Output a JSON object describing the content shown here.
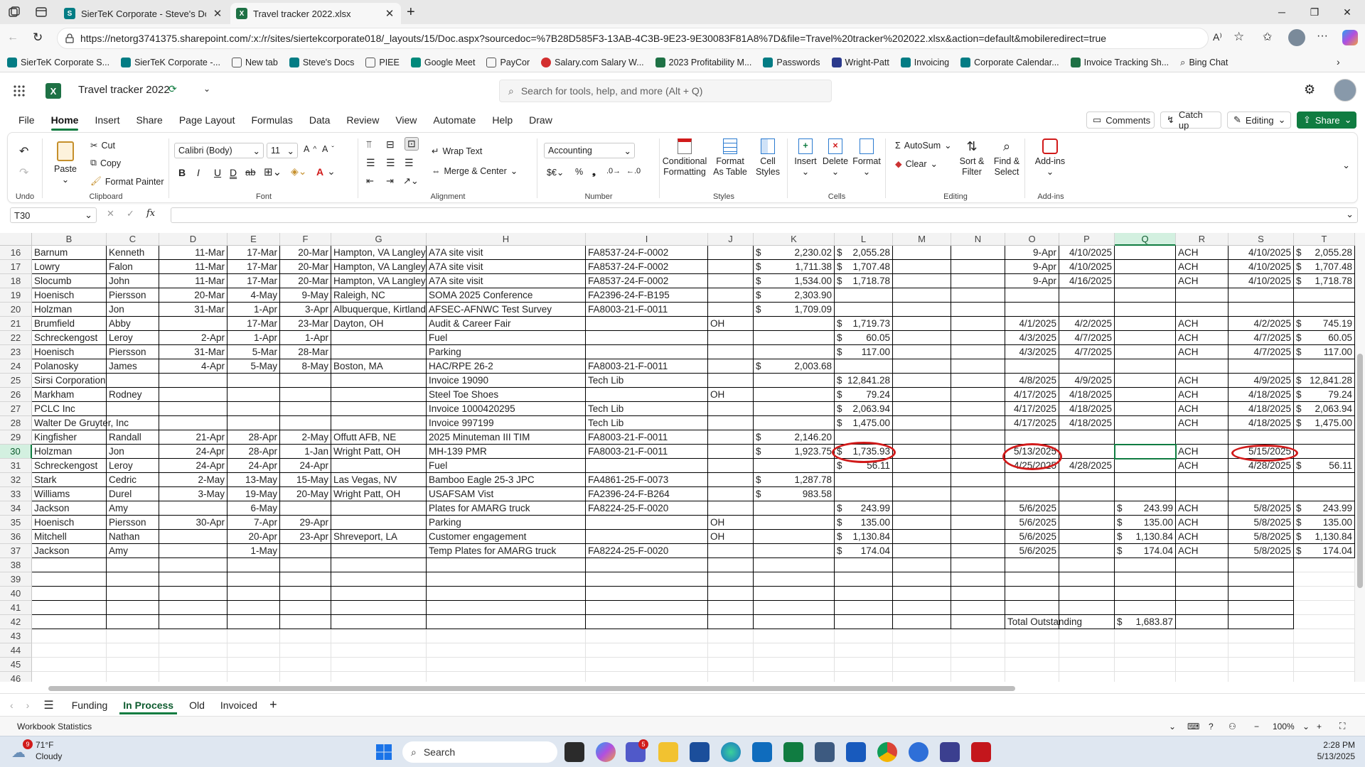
{
  "browser": {
    "tabs": [
      {
        "label": "SierTeK Corporate - Steve's Docs",
        "active": false
      },
      {
        "label": "Travel tracker 2022.xlsx",
        "active": true
      }
    ],
    "url": "https://netorg3741375.sharepoint.com/:x:/r/sites/siertekcorporate018/_layouts/15/Doc.aspx?sourcedoc=%7B28D585F3-13AB-4C3B-9E23-9E30083F81A8%7D&file=Travel%20tracker%202022.xlsx&action=default&mobileredirect=true",
    "bookmarks": [
      "SierTeK Corporate S...",
      "SierTeK Corporate -...",
      "New tab",
      "Steve's Docs",
      "PIEE",
      "Google Meet",
      "PayCor",
      "Salary.com Salary W...",
      "2023 Profitability M...",
      "Passwords",
      "Wright-Patt",
      "Invoicing",
      "Corporate Calendar...",
      "Invoice Tracking Sh...",
      "Bing Chat"
    ]
  },
  "excel": {
    "file_title": "Travel tracker 2022",
    "search_placeholder": "Search for tools, help, and more (Alt + Q)",
    "menus": [
      "File",
      "Home",
      "Insert",
      "Share",
      "Page Layout",
      "Formulas",
      "Data",
      "Review",
      "View",
      "Automate",
      "Help",
      "Draw"
    ],
    "buttons": {
      "comments": "Comments",
      "catchup": "Catch up",
      "editing": "Editing",
      "share": "Share"
    },
    "ribbon": {
      "undo_label": "Undo",
      "paste": "Paste",
      "cut": "Cut",
      "copy": "Copy",
      "format_painter": "Format Painter",
      "clipboard_label": "Clipboard",
      "font_name": "Calibri (Body)",
      "font_size": "11",
      "font_label": "Font",
      "wrap_text": "Wrap Text",
      "merge_center": "Merge & Center",
      "alignment_label": "Alignment",
      "number_format": "Accounting",
      "number_label": "Number",
      "conditional": "Conditional Formatting",
      "format_table": "Format As Table",
      "cell_styles": "Cell Styles",
      "styles_label": "Styles",
      "insert": "Insert",
      "delete": "Delete",
      "format": "Format",
      "cells_label": "Cells",
      "autosum": "AutoSum",
      "clear": "Clear",
      "sort_filter": "Sort & Filter",
      "find_select": "Find & Select",
      "editing_label": "Editing",
      "addins": "Add-ins",
      "addins_label": "Add-ins"
    },
    "name_box": "T30",
    "fx": "fx",
    "columns": [
      "B",
      "C",
      "D",
      "E",
      "F",
      "G",
      "H",
      "I",
      "J",
      "K",
      "L",
      "M",
      "N",
      "O",
      "P",
      "Q",
      "R",
      "S",
      "T"
    ],
    "rows": [
      {
        "n": "16",
        "B": "Barnum",
        "C": "Kenneth",
        "D": "11-Mar",
        "E": "17-Mar",
        "F": "20-Mar",
        "G": "Hampton, VA Langley",
        "H": "A7A site visit",
        "I": "FA8537-24-F-0002",
        "J": "",
        "K": "2,230.02",
        "L": "2,055.28",
        "M": "",
        "N": "",
        "O": "9-Apr",
        "P": "4/10/2025",
        "Q": "",
        "R": "ACH",
        "S": "4/10/2025",
        "T": "2,055.28"
      },
      {
        "n": "17",
        "B": "Lowry",
        "C": "Falon",
        "D": "11-Mar",
        "E": "17-Mar",
        "F": "20-Mar",
        "G": "Hampton, VA Langley",
        "H": "A7A site visit",
        "I": "FA8537-24-F-0002",
        "J": "",
        "K": "1,711.38",
        "L": "1,707.48",
        "M": "",
        "N": "",
        "O": "9-Apr",
        "P": "4/10/2025",
        "Q": "",
        "R": "ACH",
        "S": "4/10/2025",
        "T": "1,707.48"
      },
      {
        "n": "18",
        "B": "Slocumb",
        "C": "John",
        "D": "11-Mar",
        "E": "17-Mar",
        "F": "20-Mar",
        "G": "Hampton, VA Langley",
        "H": "A7A site visit",
        "I": "FA8537-24-F-0002",
        "J": "",
        "K": "1,534.00",
        "L": "1,718.78",
        "M": "",
        "N": "",
        "O": "9-Apr",
        "P": "4/16/2025",
        "Q": "",
        "R": "ACH",
        "S": "4/10/2025",
        "T": "1,718.78"
      },
      {
        "n": "19",
        "B": "Hoenisch",
        "C": "Piersson",
        "D": "20-Mar",
        "E": "4-May",
        "F": "9-May",
        "G": "Raleigh, NC",
        "H": "SOMA 2025 Conference",
        "I": "FA2396-24-F-B195",
        "J": "",
        "K": "2,303.90",
        "L": "",
        "M": "",
        "N": "",
        "O": "",
        "P": "",
        "Q": "",
        "R": "",
        "S": "",
        "T": ""
      },
      {
        "n": "20",
        "B": "Holzman",
        "C": "Jon",
        "D": "31-Mar",
        "E": "1-Apr",
        "F": "3-Apr",
        "G": "Albuquerque, Kirtland",
        "H": "AFSEC-AFNWC Test Survey",
        "I": "FA8003-21-F-0011",
        "J": "",
        "K": "1,709.09",
        "L": "",
        "M": "",
        "N": "",
        "O": "",
        "P": "",
        "Q": "",
        "R": "",
        "S": "",
        "T": ""
      },
      {
        "n": "21",
        "B": "Brumfield",
        "C": "Abby",
        "D": "",
        "E": "17-Mar",
        "F": "23-Mar",
        "G": "Dayton, OH",
        "H": "Audit & Career Fair",
        "I": "",
        "J": "OH",
        "K": "",
        "L": "1,719.73",
        "M": "",
        "N": "",
        "O": "4/1/2025",
        "P": "4/2/2025",
        "Q": "",
        "R": "ACH",
        "S": "4/2/2025",
        "T": "745.19"
      },
      {
        "n": "22",
        "B": "Schreckengost",
        "C": "Leroy",
        "D": "2-Apr",
        "E": "1-Apr",
        "F": "1-Apr",
        "G": "",
        "H": "Fuel",
        "I": "",
        "J": "",
        "K": "",
        "L": "60.05",
        "M": "",
        "N": "",
        "O": "4/3/2025",
        "P": "4/7/2025",
        "Q": "",
        "R": "ACH",
        "S": "4/7/2025",
        "T": "60.05"
      },
      {
        "n": "23",
        "B": "Hoenisch",
        "C": "Piersson",
        "D": "31-Mar",
        "E": "5-Mar",
        "F": "28-Mar",
        "G": "",
        "H": "Parking",
        "I": "",
        "J": "",
        "K": "",
        "L": "117.00",
        "M": "",
        "N": "",
        "O": "4/3/2025",
        "P": "4/7/2025",
        "Q": "",
        "R": "ACH",
        "S": "4/7/2025",
        "T": "117.00"
      },
      {
        "n": "24",
        "B": "Polanosky",
        "C": "James",
        "D": "4-Apr",
        "E": "5-May",
        "F": "8-May",
        "G": "Boston, MA",
        "H": "HAC/RPE 26-2",
        "I": "FA8003-21-F-0011",
        "J": "",
        "K": "2,003.68",
        "L": "",
        "M": "",
        "N": "",
        "O": "",
        "P": "",
        "Q": "",
        "R": "",
        "S": "",
        "T": ""
      },
      {
        "n": "25",
        "B": "Sirsi Corporation",
        "C": "",
        "D": "",
        "E": "",
        "F": "",
        "G": "",
        "H": "Invoice 19090",
        "I": "Tech Lib",
        "J": "",
        "K": "",
        "L": "12,841.28",
        "M": "",
        "N": "",
        "O": "4/8/2025",
        "P": "4/9/2025",
        "Q": "",
        "R": "ACH",
        "S": "4/9/2025",
        "T": "12,841.28"
      },
      {
        "n": "26",
        "B": "Markham",
        "C": "Rodney",
        "D": "",
        "E": "",
        "F": "",
        "G": "",
        "H": "Steel Toe Shoes",
        "I": "",
        "J": "OH",
        "K": "",
        "L": "79.24",
        "M": "",
        "N": "",
        "O": "4/17/2025",
        "P": "4/18/2025",
        "Q": "",
        "R": "ACH",
        "S": "4/18/2025",
        "T": "79.24"
      },
      {
        "n": "27",
        "B": "PCLC Inc",
        "C": "",
        "D": "",
        "E": "",
        "F": "",
        "G": "",
        "H": "Invoice 1000420295",
        "I": "Tech Lib",
        "J": "",
        "K": "",
        "L": "2,063.94",
        "M": "",
        "N": "",
        "O": "4/17/2025",
        "P": "4/18/2025",
        "Q": "",
        "R": "ACH",
        "S": "4/18/2025",
        "T": "2,063.94"
      },
      {
        "n": "28",
        "B": "Walter De Gruyter, Inc",
        "C": "",
        "D": "",
        "E": "",
        "F": "",
        "G": "",
        "H": "Invoice 997199",
        "I": "Tech Lib",
        "J": "",
        "K": "",
        "L": "1,475.00",
        "M": "",
        "N": "",
        "O": "4/17/2025",
        "P": "4/18/2025",
        "Q": "",
        "R": "ACH",
        "S": "4/18/2025",
        "T": "1,475.00"
      },
      {
        "n": "29",
        "B": "Kingfisher",
        "C": "Randall",
        "D": "21-Apr",
        "E": "28-Apr",
        "F": "2-May",
        "G": "Offutt AFB, NE",
        "H": "2025 Minuteman III TIM",
        "I": "FA8003-21-F-0011",
        "J": "",
        "K": "2,146.20",
        "L": "",
        "M": "",
        "N": "",
        "O": "",
        "P": "",
        "Q": "",
        "R": "",
        "S": "",
        "T": ""
      },
      {
        "n": "30",
        "B": "Holzman",
        "C": "Jon",
        "D": "24-Apr",
        "E": "28-Apr",
        "F": "1-Jan",
        "G": "Wright Patt, OH",
        "H": "MH-139 PMR",
        "I": "FA8003-21-F-0011",
        "J": "",
        "K": "1,923.75",
        "L": "1,735.93",
        "M": "",
        "N": "",
        "O": "5/13/2025",
        "P": "",
        "Q": "",
        "R": "ACH",
        "S": "5/15/2025",
        "T": ""
      },
      {
        "n": "31",
        "B": "Schreckengost",
        "C": "Leroy",
        "D": "24-Apr",
        "E": "24-Apr",
        "F": "24-Apr",
        "G": "",
        "H": "Fuel",
        "I": "",
        "J": "",
        "K": "",
        "L": "56.11",
        "M": "",
        "N": "",
        "O": "4/25/2025",
        "P": "4/28/2025",
        "Q": "",
        "R": "ACH",
        "S": "4/28/2025",
        "T": "56.11"
      },
      {
        "n": "32",
        "B": "Stark",
        "C": "Cedric",
        "D": "2-May",
        "E": "13-May",
        "F": "15-May",
        "G": "Las Vegas, NV",
        "H": "Bamboo Eagle 25-3 JPC",
        "I": "FA4861-25-F-0073",
        "J": "",
        "K": "1,287.78",
        "L": "",
        "M": "",
        "N": "",
        "O": "",
        "P": "",
        "Q": "",
        "R": "",
        "S": "",
        "T": ""
      },
      {
        "n": "33",
        "B": "Williams",
        "C": "Durel",
        "D": "3-May",
        "E": "19-May",
        "F": "20-May",
        "G": "Wright Patt, OH",
        "H": "USAFSAM Vist",
        "I": "FA2396-24-F-B264",
        "J": "",
        "K": "983.58",
        "L": "",
        "M": "",
        "N": "",
        "O": "",
        "P": "",
        "Q": "",
        "R": "",
        "S": "",
        "T": ""
      },
      {
        "n": "34",
        "B": "Jackson",
        "C": "Amy",
        "D": "",
        "E": "6-May",
        "F": "",
        "G": "",
        "H": "Plates for AMARG truck",
        "I": "FA8224-25-F-0020",
        "J": "",
        "K": "",
        "L": "243.99",
        "M": "",
        "N": "",
        "O": "5/6/2025",
        "P": "",
        "Q": "243.99",
        "R": "ACH",
        "S": "5/8/2025",
        "T": "243.99"
      },
      {
        "n": "35",
        "B": "Hoenisch",
        "C": "Piersson",
        "D": "30-Apr",
        "E": "7-Apr",
        "F": "29-Apr",
        "G": "",
        "H": "Parking",
        "I": "",
        "J": "OH",
        "K": "",
        "L": "135.00",
        "M": "",
        "N": "",
        "O": "5/6/2025",
        "P": "",
        "Q": "135.00",
        "R": "ACH",
        "S": "5/8/2025",
        "T": "135.00"
      },
      {
        "n": "36",
        "B": "Mitchell",
        "C": "Nathan",
        "D": "",
        "E": "20-Apr",
        "F": "23-Apr",
        "G": "Shreveport, LA",
        "H": "Customer engagement",
        "I": "",
        "J": "OH",
        "K": "",
        "L": "1,130.84",
        "M": "",
        "N": "",
        "O": "5/6/2025",
        "P": "",
        "Q": "1,130.84",
        "R": "ACH",
        "S": "5/8/2025",
        "T": "1,130.84"
      },
      {
        "n": "37",
        "B": "Jackson",
        "C": "Amy",
        "D": "",
        "E": "1-May",
        "F": "",
        "G": "",
        "H": "Temp Plates for AMARG truck",
        "I": "FA8224-25-F-0020",
        "J": "",
        "K": "",
        "L": "174.04",
        "M": "",
        "N": "",
        "O": "5/6/2025",
        "P": "",
        "Q": "174.04",
        "R": "ACH",
        "S": "5/8/2025",
        "T": "174.04"
      },
      {
        "n": "38"
      },
      {
        "n": "39"
      },
      {
        "n": "40"
      },
      {
        "n": "41"
      },
      {
        "n": "42",
        "O": "Total Outstanding",
        "Q": "1,683.87"
      },
      {
        "n": "43"
      },
      {
        "n": "44"
      },
      {
        "n": "45"
      },
      {
        "n": "46"
      }
    ],
    "currency_symbol": "$",
    "sheets": [
      "Funding",
      "In Process",
      "Old",
      "Invoiced"
    ],
    "active_sheet": "In Process",
    "status_left": "Workbook Statistics",
    "zoom": "100%"
  },
  "taskbar": {
    "weather_temp": "71°F",
    "weather_desc": "Cloudy",
    "weather_badge": "9",
    "search": "Search",
    "teams_badge": "5",
    "time": "2:28 PM",
    "date": "5/13/2025"
  },
  "colors": {
    "excel_green": "#107c41",
    "annotation_red": "#d11a1a"
  }
}
